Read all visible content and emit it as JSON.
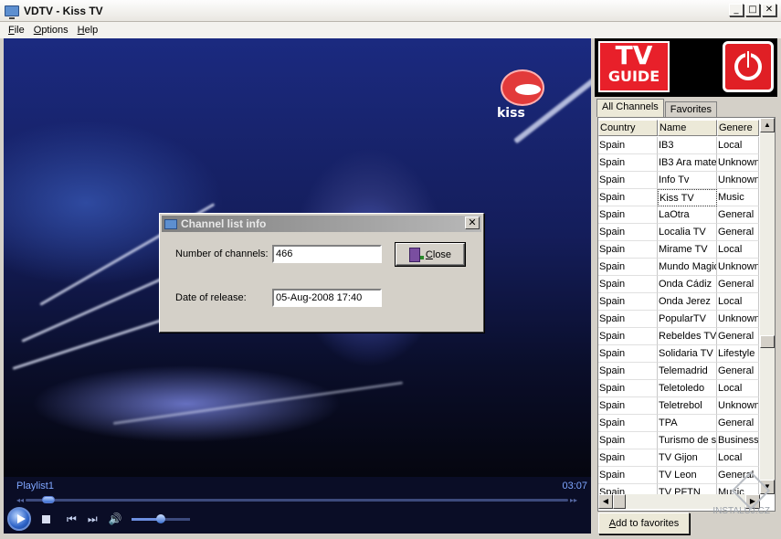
{
  "window": {
    "title": "VDTV - Kiss TV",
    "min": "0",
    "max": "1",
    "close": "r"
  },
  "menu": [
    {
      "label": "File",
      "accel": "F",
      "rest": "ile"
    },
    {
      "label": "Options",
      "accel": "O",
      "rest": "ptions"
    },
    {
      "label": "Help",
      "accel": "H",
      "rest": "elp"
    }
  ],
  "video": {
    "channel_logo_text": "kiss"
  },
  "player": {
    "playlist": "Playlist1",
    "time": "03:07",
    "seek_position": 0.03,
    "volume": 0.5
  },
  "logos": {
    "tvguide_top": "TV",
    "tvguide_bottom": "GUIDE"
  },
  "tabs": [
    {
      "label": "All Channels",
      "active": true
    },
    {
      "label": "Favorites",
      "active": false
    }
  ],
  "table": {
    "columns": [
      "Country",
      "Name",
      "Genere"
    ],
    "rows": [
      [
        "Spain",
        "IB3",
        "Local"
      ],
      [
        "Spain",
        "IB3 Ara mate",
        "Unknown"
      ],
      [
        "Spain",
        "Info Tv",
        "Unknown"
      ],
      [
        "Spain",
        "Kiss TV",
        "Music"
      ],
      [
        "Spain",
        "LaOtra",
        "General"
      ],
      [
        "Spain",
        "Localia TV",
        "General"
      ],
      [
        "Spain",
        "Mirame TV",
        "Local"
      ],
      [
        "Spain",
        "Mundo Magic",
        "Unknown"
      ],
      [
        "Spain",
        "Onda Cádiz",
        "General"
      ],
      [
        "Spain",
        "Onda Jerez",
        "Local"
      ],
      [
        "Spain",
        "PopularTV",
        "Unknown"
      ],
      [
        "Spain",
        "Rebeldes TV",
        "General"
      ],
      [
        "Spain",
        "Solidaria TV",
        "Lifestyle"
      ],
      [
        "Spain",
        "Telemadrid",
        "General"
      ],
      [
        "Spain",
        "Teletoledo",
        "Local"
      ],
      [
        "Spain",
        "Teletrebol",
        "Unknown"
      ],
      [
        "Spain",
        "TPA",
        "General"
      ],
      [
        "Spain",
        "Turismo de se",
        "Business"
      ],
      [
        "Spain",
        "TV Gijon",
        "Local"
      ],
      [
        "Spain",
        "TV Leon",
        "General"
      ],
      [
        "Spain",
        "TV PFTN",
        "Music"
      ]
    ],
    "selected_row": 3
  },
  "buttons": {
    "add_favorites": "Add to favorites",
    "add_accel": "A",
    "add_rest": "dd to favorites"
  },
  "watermark": {
    "text": "INSTALUJ.CZ"
  },
  "dialog": {
    "title": "Channel list info",
    "count_label": "Number of channels:",
    "count_value": "466",
    "date_label": "Date of release:",
    "date_value": "05-Aug-2008 17:40",
    "close_label": "Close",
    "close_accel": "C",
    "close_rest": "lose",
    "x": "✕"
  }
}
